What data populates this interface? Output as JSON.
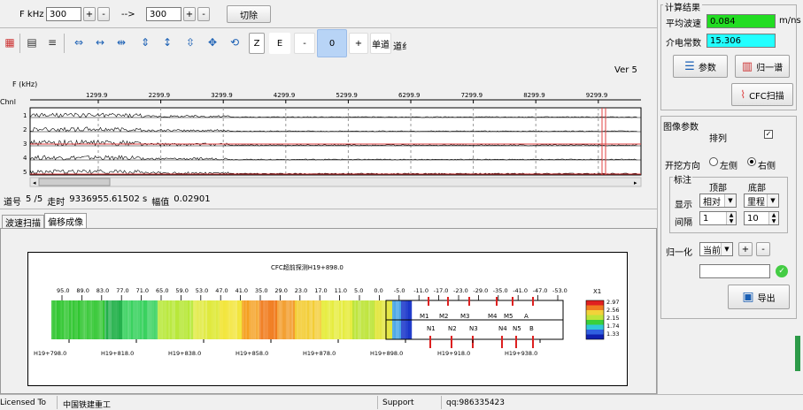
{
  "toolbar": {
    "freq_label": "F kHz",
    "freq_from": "300",
    "arrow_label": "-->",
    "freq_to": "300",
    "plus": "+",
    "minus": "-",
    "cut_label": "切除",
    "z_label": "Z",
    "e_label": "E",
    "step_minus": "-",
    "step_value": "0",
    "step_plus": "+",
    "single_channel": "单道",
    "channel_tab": "道纟"
  },
  "trace": {
    "version": "Ver 5",
    "axis_unit": "F (kHz)",
    "channel_label": "Chnl",
    "x_ticks": [
      "1299.9",
      "2299.9",
      "3299.9",
      "4299.9",
      "5299.9",
      "6299.9",
      "7299.9",
      "8299.9",
      "9299.9"
    ],
    "channels": [
      "1",
      "2",
      "3",
      "4",
      "5"
    ]
  },
  "status": {
    "trace_no_label": "道号",
    "trace_no": "5 /5",
    "time_label": "走时",
    "time": "9336955.61502 s",
    "amp_label": "幅值",
    "amp": "0.02901"
  },
  "tabs": [
    "波速扫描",
    "偏移成像"
  ],
  "image_panel": {
    "title": "CFC超前探测H19+898.0",
    "top_ticks": [
      "95.0",
      "89.0",
      "83.0",
      "77.0",
      "71.0",
      "65.0",
      "59.0",
      "53.0",
      "47.0",
      "41.0",
      "35.0",
      "29.0",
      "23.0",
      "17.0",
      "11.0",
      "5.0",
      "0.0",
      "-5.0",
      "-11.0",
      "-17.0",
      "-23.0",
      "-29.0",
      "-35.0",
      "-41.0",
      "-47.0",
      "-53.0"
    ],
    "bottom_ticks": [
      "H19+798.0",
      "H19+818.0",
      "H19+838.0",
      "H19+858.0",
      "H19+878.0",
      "H19+898.0",
      "H19+918.0",
      "H19+938.0"
    ],
    "markers_top": [
      "M1",
      "M2",
      "M3",
      "M4",
      "M5",
      "A"
    ],
    "markers_bottom": [
      "N1",
      "N2",
      "N3",
      "N4",
      "N5",
      "B"
    ],
    "legend_title": "X1",
    "legend_values": [
      "2.97",
      "2.56",
      "2.15",
      "1.74",
      "1.33"
    ]
  },
  "results": {
    "header": "计算结果",
    "velocity_label": "平均波速",
    "velocity_value": "0.084",
    "velocity_unit": "m/ns",
    "dielectric_label": "介电常数",
    "dielectric_value": "15.306",
    "params_button": "参数",
    "normalize_button": "归一谱",
    "cfc_scan_button": "CFC扫描"
  },
  "image_params": {
    "header": "图像参数",
    "arrange_label": "排列",
    "dig_dir_label": "开挖方向",
    "left_option": "左侧",
    "right_option": "右侧",
    "annotation_group": "标注",
    "top_col": "顶部",
    "bottom_col": "底部",
    "display_label": "显示",
    "display_top": "相对",
    "display_bottom": "里程",
    "interval_label": "间隔",
    "interval_top": "1",
    "interval_bottom": "10",
    "normalize_label": "归一化",
    "normalize_value": "当前",
    "plus": "+",
    "minus": "-",
    "export_button": "导出"
  },
  "footer": {
    "licensed_label": "Licensed To",
    "licensee": "中国铁建重工",
    "support_label": "Support",
    "support_value": "qq:986335423"
  },
  "colors": {
    "velocity_bg": "#22dd22",
    "dielectric_bg": "#22ffff",
    "trace_red": "#e04040",
    "marker_red": "#dd2020",
    "image_blue": "#1030c0"
  }
}
